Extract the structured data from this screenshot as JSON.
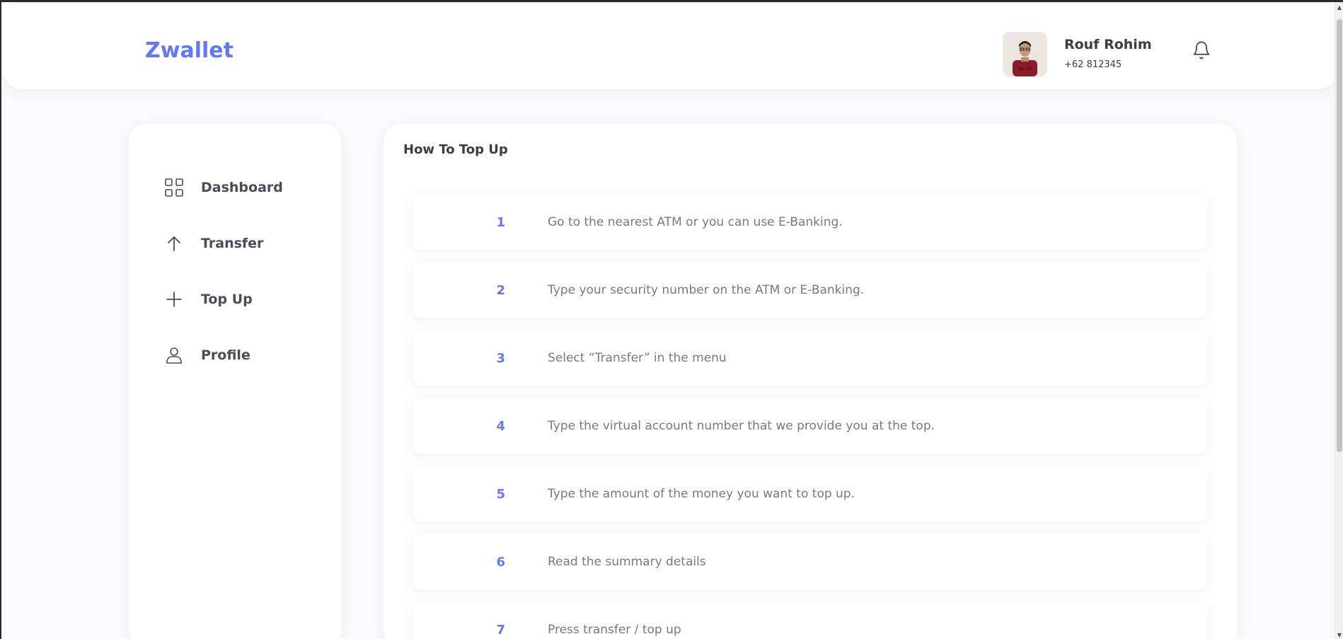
{
  "header": {
    "brand": "Zwallet",
    "user": {
      "name": "Rouf Rohim",
      "phone": "+62 812345"
    }
  },
  "sidebar": {
    "items": [
      {
        "label": "Dashboard",
        "icon": "grid-icon"
      },
      {
        "label": "Transfer",
        "icon": "arrow-up-icon"
      },
      {
        "label": "Top Up",
        "icon": "plus-icon"
      },
      {
        "label": "Profile",
        "icon": "user-icon"
      }
    ]
  },
  "main": {
    "title": "How To Top Up",
    "steps": [
      {
        "number": "1",
        "text": "Go to the nearest ATM or you can use E-Banking."
      },
      {
        "number": "2",
        "text": "Type your security number on the ATM or E-Banking."
      },
      {
        "number": "3",
        "text": "Select “Transfer” in the menu"
      },
      {
        "number": "4",
        "text": "Type the virtual account number that we provide you at the top."
      },
      {
        "number": "5",
        "text": "Type the amount of the money you want to top up."
      },
      {
        "number": "6",
        "text": "Read the summary details"
      },
      {
        "number": "7",
        "text": "Press transfer / top up"
      }
    ]
  },
  "colors": {
    "accent": "#6379f4",
    "text": "#3a3d42",
    "muted": "#7a7886"
  }
}
